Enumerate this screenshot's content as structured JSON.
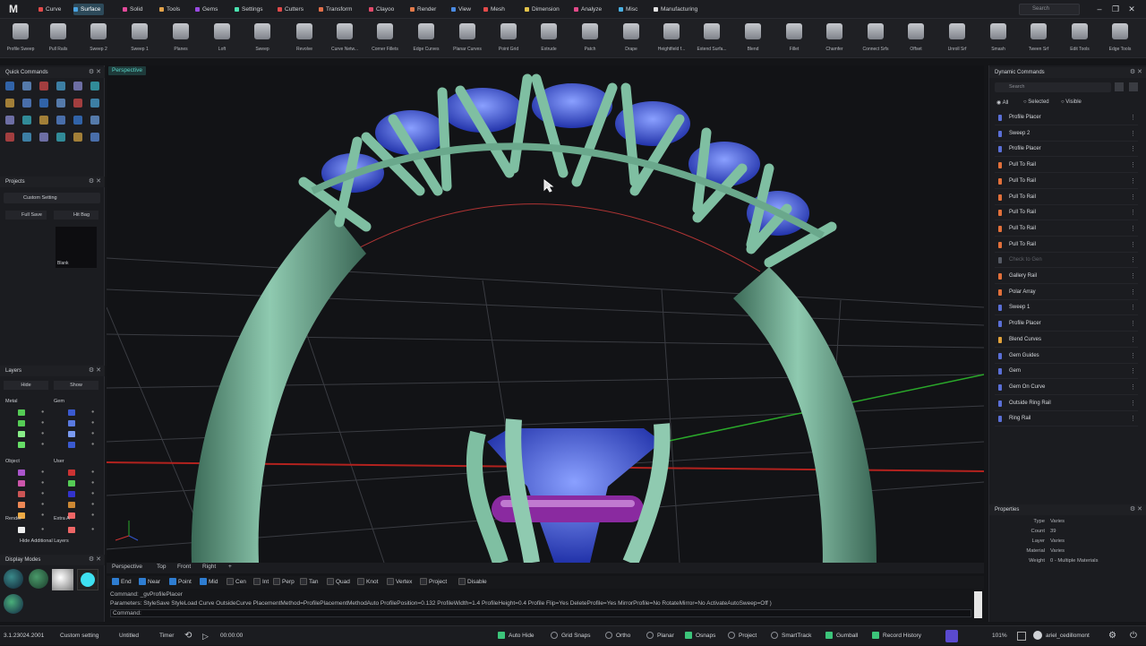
{
  "menubar": {
    "tabs": [
      {
        "label": "Curve",
        "color": "#e24a4a"
      },
      {
        "label": "Surface",
        "color": "#4aa3e2"
      },
      {
        "label": "Solid",
        "color": "#e24a9a"
      },
      {
        "label": "Tools",
        "color": "#e2a24a"
      },
      {
        "label": "Gems",
        "color": "#9a4ae2"
      },
      {
        "label": "Settings",
        "color": "#4ae2b0"
      },
      {
        "label": "Cutters",
        "color": "#e24a4a"
      },
      {
        "label": "Transform",
        "color": "#e2704a"
      },
      {
        "label": "Clayoo",
        "color": "#e24a6a"
      },
      {
        "label": "Render",
        "color": "#e27a4a"
      },
      {
        "label": "View",
        "color": "#4a8ae2"
      },
      {
        "label": "Mesh",
        "color": "#e24a4a"
      },
      {
        "label": "Dimension",
        "color": "#e2c24a"
      },
      {
        "label": "Analyze",
        "color": "#e24a8a"
      },
      {
        "label": "Misc",
        "color": "#4ab0e2"
      },
      {
        "label": "Manufacturing",
        "color": "#e2e2e2"
      }
    ],
    "search_placeholder": "Search"
  },
  "toolbar": {
    "tools": [
      "Profile Sweep",
      "Pull Rails",
      "Sweep 2",
      "Sweep 1",
      "Planes",
      "Loft",
      "Sweep",
      "Revolve",
      "Curve Netw...",
      "Corner Fillets",
      "Edge Curves",
      "Planar Curves",
      "Point Grid",
      "Extrude",
      "Patch",
      "Drape",
      "Heightfield f...",
      "Extend Surfa...",
      "Blend",
      "Fillet",
      "Chamfer",
      "Connect Srfs",
      "Offset",
      "Unroll Srf",
      "Smash",
      "Tween Srf",
      "Edit Tools",
      "Edge Tools"
    ]
  },
  "left": {
    "quick_title": "Quick Commands",
    "projects_title": "Projects",
    "project_setting": "Custom Setting",
    "full_save": "Full Save",
    "hit_bag": "Hit Bag",
    "thumb_label": "Blank",
    "layers_title": "Layers",
    "hide_btn": "Hide",
    "show_btn": "Show",
    "groups": [
      {
        "left": "Metal",
        "right": "Gem"
      },
      {
        "left": "Object",
        "right": "User"
      },
      {
        "left": "Render",
        "right": "Extra A"
      }
    ],
    "hide_additional": "Hide Additional Layers",
    "display_title": "Display Modes"
  },
  "viewport": {
    "tab": "Perspective",
    "views": [
      "Perspective",
      "Top",
      "Front",
      "Right",
      "+"
    ]
  },
  "snaps": [
    {
      "label": "End",
      "on": true
    },
    {
      "label": "Near",
      "on": true
    },
    {
      "label": "Point",
      "on": true
    },
    {
      "label": "Mid",
      "on": true
    },
    {
      "label": "Cen",
      "on": false
    },
    {
      "label": "Int",
      "on": false
    },
    {
      "label": "Perp",
      "on": false
    },
    {
      "label": "Tan",
      "on": false
    },
    {
      "label": "Quad",
      "on": false
    },
    {
      "label": "Knot",
      "on": false
    },
    {
      "label": "Vertex",
      "on": false
    },
    {
      "label": "Project",
      "on": false
    },
    {
      "label": "Disable",
      "on": false
    }
  ],
  "cmdline": {
    "line1": "Command: _gvProfilePlacer",
    "line2": "Parameters: StyleSave  StyleLoad  Curve  OutsideCurve  PlacementMethod=ProfilePlacementMethodAuto  ProfilePosition=0.132  ProfileWidth=1.4  ProfileHeight=0.4  Profile  Flip=Yes  DeleteProfile=Yes  MirrorProfile=No  RotateMirror=No  ActivateAutoSweep=Off )",
    "line3": "Command:"
  },
  "right": {
    "title": "Dynamic Commands",
    "search_placeholder": "Search",
    "filters": [
      "All",
      "Selected",
      "Visible"
    ],
    "commands": [
      {
        "label": "Profile Placer",
        "color": "#5a6fd6",
        "dim": false
      },
      {
        "label": "Sweep 2",
        "color": "#5a6fd6",
        "dim": false
      },
      {
        "label": "Profile Placer",
        "color": "#5a6fd6",
        "dim": false
      },
      {
        "label": "Pull To Rail",
        "color": "#e2703a",
        "dim": false
      },
      {
        "label": "Pull To Rail",
        "color": "#e2703a",
        "dim": false
      },
      {
        "label": "Pull To Rail",
        "color": "#e2703a",
        "dim": false
      },
      {
        "label": "Pull To Rail",
        "color": "#e2703a",
        "dim": false
      },
      {
        "label": "Pull To Rail",
        "color": "#e2703a",
        "dim": false
      },
      {
        "label": "Pull To Rail",
        "color": "#e2703a",
        "dim": false
      },
      {
        "label": "Check to Gen",
        "color": "#555a64",
        "dim": true
      },
      {
        "label": "Gallery Rail",
        "color": "#e2703a",
        "dim": false
      },
      {
        "label": "Polar Array",
        "color": "#e2703a",
        "dim": false
      },
      {
        "label": "Sweep 1",
        "color": "#5a6fd6",
        "dim": false
      },
      {
        "label": "Profile Placer",
        "color": "#5a6fd6",
        "dim": false
      },
      {
        "label": "Blend Curves",
        "color": "#e2a23a",
        "dim": false
      },
      {
        "label": "Gem Guides",
        "color": "#5a6fd6",
        "dim": false
      },
      {
        "label": "Gem",
        "color": "#5a6fd6",
        "dim": false
      },
      {
        "label": "Gem On Curve",
        "color": "#5a6fd6",
        "dim": false
      },
      {
        "label": "Outside Ring Rail",
        "color": "#5a6fd6",
        "dim": false
      },
      {
        "label": "Ring Rail",
        "color": "#5a6fd6",
        "dim": false
      }
    ],
    "properties_title": "Properties",
    "properties": [
      {
        "key": "Type",
        "val": "Varies"
      },
      {
        "key": "Count",
        "val": "39"
      },
      {
        "key": "Layer",
        "val": "Varies"
      },
      {
        "key": "Material",
        "val": "Varies"
      },
      {
        "key": "Weight",
        "val": "0 - Multiple Materials"
      }
    ]
  },
  "status": {
    "version": "3.1.23024.2001",
    "setting": "Custom setting",
    "file": "Untitled",
    "timer_label": "Timer",
    "timer": "00:00:00",
    "toggles": [
      {
        "label": "Auto Hide",
        "on": true
      },
      {
        "label": "Grid Snaps",
        "on": false
      },
      {
        "label": "Ortho",
        "on": false
      },
      {
        "label": "Planar",
        "on": false
      },
      {
        "label": "Osnaps",
        "on": true
      },
      {
        "label": "Project",
        "on": false
      },
      {
        "label": "SmartTrack",
        "on": false
      },
      {
        "label": "Gumball",
        "on": true
      },
      {
        "label": "Record History",
        "on": true
      }
    ],
    "zoom": "101%",
    "user": "ariel_cedillomont"
  }
}
